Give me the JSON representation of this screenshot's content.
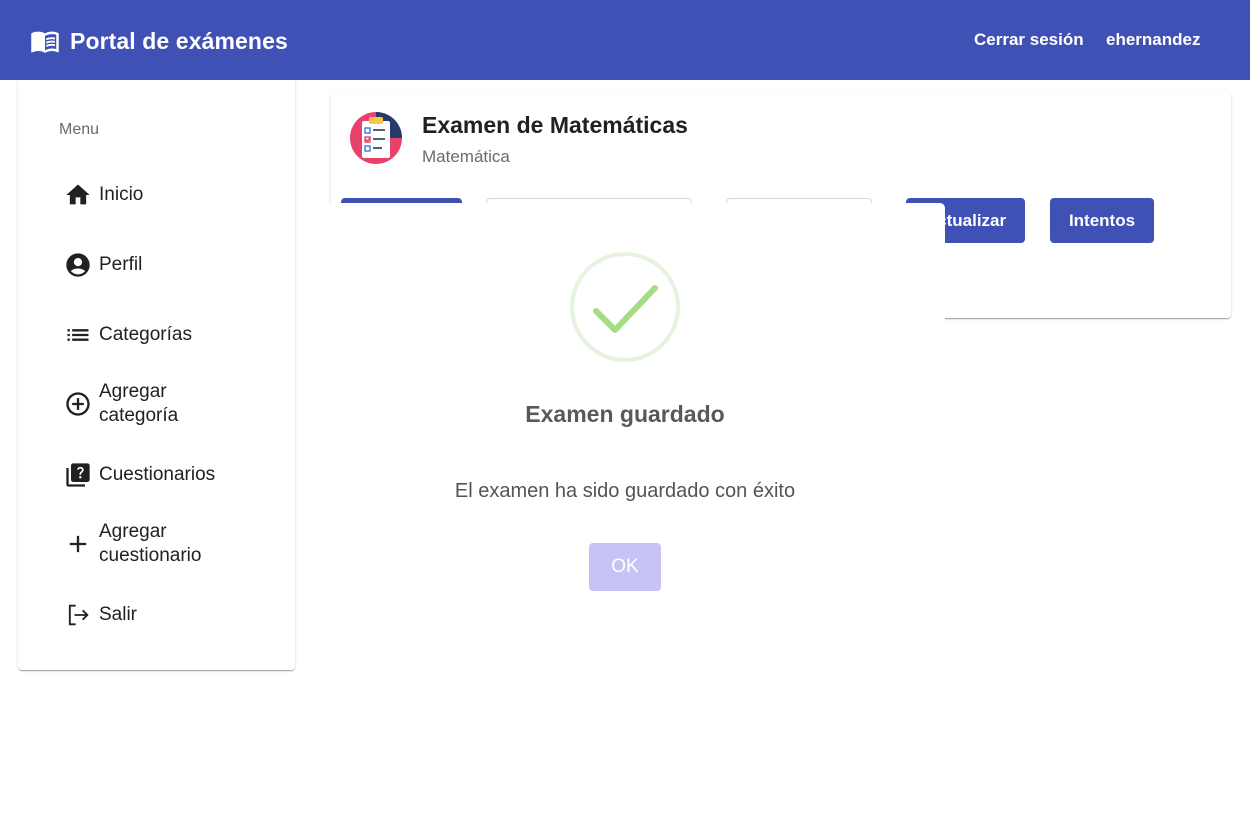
{
  "header": {
    "brand_icon": "open-book-icon",
    "title": "Portal de exámenes",
    "logout_label": "Cerrar sesión",
    "username": "ehernandez",
    "bg_color": "#3f51b5"
  },
  "sidebar": {
    "title": "Menu",
    "items": [
      {
        "icon": "home-icon",
        "label": "Inicio"
      },
      {
        "icon": "account-circle-icon",
        "label": "Perfil"
      },
      {
        "icon": "list-icon",
        "label": "Categorías"
      },
      {
        "icon": "add-circle-outline-icon",
        "label": "Agregar categoría"
      },
      {
        "icon": "quiz-icon",
        "label": "Cuestionarios"
      },
      {
        "icon": "add-icon",
        "label": "Agregar cuestionario"
      },
      {
        "icon": "logout-icon",
        "label": "Salir"
      }
    ]
  },
  "exam_card": {
    "avatar_icon": "exam-checklist-icon",
    "title": "Examen de Matemáticas",
    "subtitle": "Matemática",
    "buttons": {
      "update_label": "Actualizar",
      "attempts_label": "Intentos"
    }
  },
  "dialog": {
    "icon": "success-check-icon",
    "title": "Examen guardado",
    "text": "El examen ha sido guardado con éxito",
    "ok_label": "OK",
    "check_color": "#a5dc86",
    "ok_color": "#c8c3f5"
  }
}
